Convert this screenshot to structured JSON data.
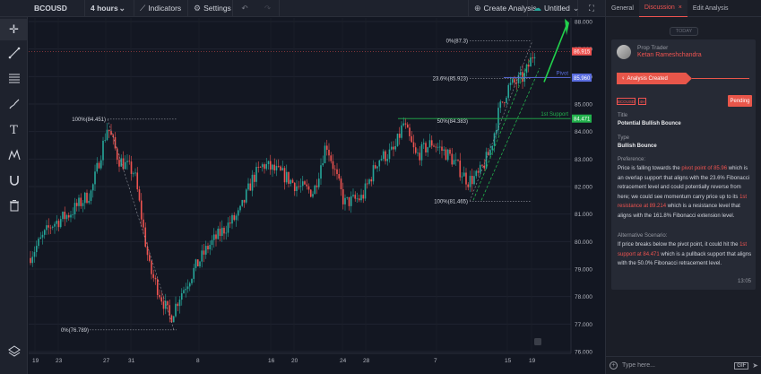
{
  "toolbar": {
    "symbol": "BCOUSD",
    "interval": "4 hours",
    "indicators_label": "Indicators",
    "settings_label": "Settings",
    "create_analysis_label": "Create Analysis",
    "layout_name": "Untitled"
  },
  "tools": [
    "crosshair-icon",
    "trend-line-icon",
    "fib-lines-icon",
    "brush-icon",
    "text-icon",
    "pattern-icon",
    "magnet-icon",
    "trash-icon",
    "layers-icon"
  ],
  "chart_data": {
    "type": "candlestick",
    "symbol": "BCOUSD",
    "interval": "4 hours",
    "y_ticks": [
      "88.000",
      "87.000",
      "86.000",
      "85.000",
      "84.000",
      "83.000",
      "82.000",
      "81.000",
      "80.000",
      "79.000",
      "78.000",
      "77.000",
      "76.000"
    ],
    "ylim": [
      76.0,
      88.0
    ],
    "x_ticks": [
      "19",
      "23",
      "27",
      "31",
      "8",
      "16",
      "20",
      "24",
      "28",
      "7",
      "15",
      "19"
    ],
    "current_price": "86.915",
    "price_labels": [
      {
        "text": "85.960",
        "price": 85.96,
        "color": "#5b6ee1"
      },
      {
        "text": "84.471",
        "price": 84.471,
        "color": "#22b14c"
      }
    ],
    "horizontal_lines": [
      {
        "label": "Pivot",
        "price": 85.96,
        "color": "#5b6ee1"
      },
      {
        "label": "1st Support",
        "price": 84.471,
        "color": "#22b14c"
      }
    ],
    "fib_labels": [
      {
        "text": "100%(84.451)",
        "price": 84.451
      },
      {
        "text": "0%(76.789)",
        "price": 76.789
      },
      {
        "text": "0%(87.3)",
        "price": 87.3
      },
      {
        "text": "23.6%(85.923)",
        "price": 85.923
      },
      {
        "text": "50%(84.383)",
        "price": 84.383
      },
      {
        "text": "100%(81.465)",
        "price": 81.465
      }
    ]
  },
  "panel": {
    "tabs": [
      {
        "label": "General"
      },
      {
        "label": "Discussion"
      },
      {
        "label": "Edit Analysis"
      }
    ],
    "today_label": "TODAY",
    "card": {
      "role": "Prop Trader",
      "user": "Ketan Rameshchandra",
      "status_banner": "Analysis Created",
      "badges": [
        "BCOUSD",
        "4H"
      ],
      "pending_label": "Pending",
      "title_label": "Title",
      "title_value": "Potential Bullish Bounce",
      "type_label": "Type",
      "type_value": "Bullish Bounce",
      "preference_label": "Preference:",
      "preference_text": [
        "Price is falling towards the ",
        "pivot point of 85.96",
        " which is an overlap support that aligns with the 23.6% Fibonacci retracement level and could potentially reverse from here; we could see momentum carry price up to its ",
        "1st resistance at 89.214",
        " which is a resistance level that aligns with the 161.8% Fibonacci extension level."
      ],
      "alt_label": "Alternative Scenario:",
      "alt_text": [
        "If price breaks below the pivot point, it could hit the ",
        "1st support at 84.471",
        " which is a pullback support that aligns with the 50.0% Fibonacci retracement level."
      ],
      "time": "13:05"
    },
    "input_placeholder": "Type here...",
    "gif_label": "GIF"
  }
}
